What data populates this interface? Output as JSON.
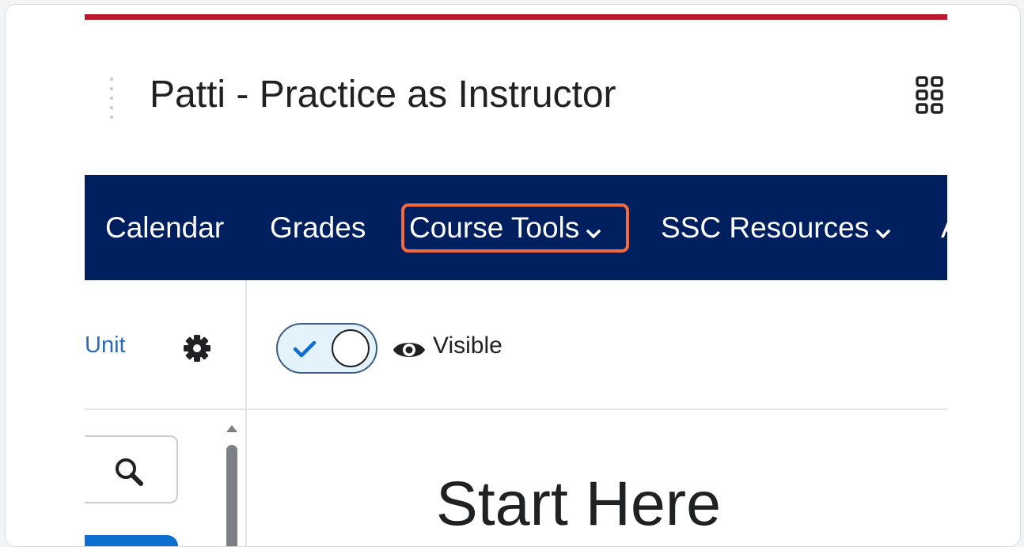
{
  "header": {
    "course_title": "Patti - Practice as Instructor",
    "apps_icon": "waffle-grid-icon"
  },
  "navbar": {
    "items": [
      {
        "label": "Calendar",
        "dropdown": false
      },
      {
        "label": "Grades",
        "dropdown": false
      },
      {
        "label": "Course Tools",
        "dropdown": true,
        "highlighted": true
      },
      {
        "label": "SSC Resources",
        "dropdown": true
      },
      {
        "label": "A",
        "dropdown": false
      }
    ]
  },
  "left_pane": {
    "unit_link": "Unit",
    "settings_icon": "gear-icon",
    "search_icon": "search-icon"
  },
  "content": {
    "visibility_label": "Visible",
    "visibility_on": true,
    "heading": "Start Here"
  },
  "colors": {
    "top_accent": "#b8192c",
    "navbar_bg": "#001f5f",
    "highlight": "#f26b3f",
    "link": "#2d6bb2",
    "toggle_check": "#0b6fd0",
    "selected_item": "#0b6fd0"
  }
}
